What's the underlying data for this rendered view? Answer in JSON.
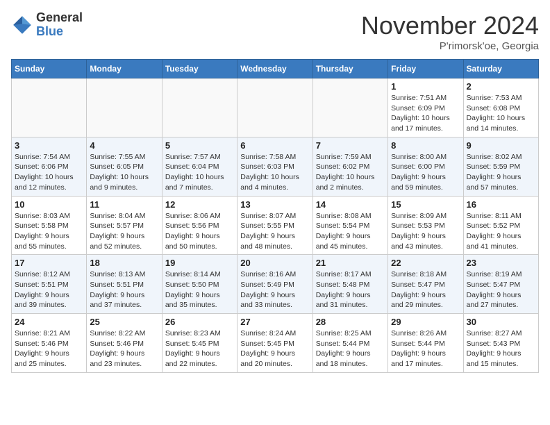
{
  "header": {
    "logo_general": "General",
    "logo_blue": "Blue",
    "month_title": "November 2024",
    "location": "P'rimorsk'oe, Georgia"
  },
  "weekdays": [
    "Sunday",
    "Monday",
    "Tuesday",
    "Wednesday",
    "Thursday",
    "Friday",
    "Saturday"
  ],
  "weeks": [
    [
      {
        "day": "",
        "info": ""
      },
      {
        "day": "",
        "info": ""
      },
      {
        "day": "",
        "info": ""
      },
      {
        "day": "",
        "info": ""
      },
      {
        "day": "",
        "info": ""
      },
      {
        "day": "1",
        "info": "Sunrise: 7:51 AM\nSunset: 6:09 PM\nDaylight: 10 hours\nand 17 minutes."
      },
      {
        "day": "2",
        "info": "Sunrise: 7:53 AM\nSunset: 6:08 PM\nDaylight: 10 hours\nand 14 minutes."
      }
    ],
    [
      {
        "day": "3",
        "info": "Sunrise: 7:54 AM\nSunset: 6:06 PM\nDaylight: 10 hours\nand 12 minutes."
      },
      {
        "day": "4",
        "info": "Sunrise: 7:55 AM\nSunset: 6:05 PM\nDaylight: 10 hours\nand 9 minutes."
      },
      {
        "day": "5",
        "info": "Sunrise: 7:57 AM\nSunset: 6:04 PM\nDaylight: 10 hours\nand 7 minutes."
      },
      {
        "day": "6",
        "info": "Sunrise: 7:58 AM\nSunset: 6:03 PM\nDaylight: 10 hours\nand 4 minutes."
      },
      {
        "day": "7",
        "info": "Sunrise: 7:59 AM\nSunset: 6:02 PM\nDaylight: 10 hours\nand 2 minutes."
      },
      {
        "day": "8",
        "info": "Sunrise: 8:00 AM\nSunset: 6:00 PM\nDaylight: 9 hours\nand 59 minutes."
      },
      {
        "day": "9",
        "info": "Sunrise: 8:02 AM\nSunset: 5:59 PM\nDaylight: 9 hours\nand 57 minutes."
      }
    ],
    [
      {
        "day": "10",
        "info": "Sunrise: 8:03 AM\nSunset: 5:58 PM\nDaylight: 9 hours\nand 55 minutes."
      },
      {
        "day": "11",
        "info": "Sunrise: 8:04 AM\nSunset: 5:57 PM\nDaylight: 9 hours\nand 52 minutes."
      },
      {
        "day": "12",
        "info": "Sunrise: 8:06 AM\nSunset: 5:56 PM\nDaylight: 9 hours\nand 50 minutes."
      },
      {
        "day": "13",
        "info": "Sunrise: 8:07 AM\nSunset: 5:55 PM\nDaylight: 9 hours\nand 48 minutes."
      },
      {
        "day": "14",
        "info": "Sunrise: 8:08 AM\nSunset: 5:54 PM\nDaylight: 9 hours\nand 45 minutes."
      },
      {
        "day": "15",
        "info": "Sunrise: 8:09 AM\nSunset: 5:53 PM\nDaylight: 9 hours\nand 43 minutes."
      },
      {
        "day": "16",
        "info": "Sunrise: 8:11 AM\nSunset: 5:52 PM\nDaylight: 9 hours\nand 41 minutes."
      }
    ],
    [
      {
        "day": "17",
        "info": "Sunrise: 8:12 AM\nSunset: 5:51 PM\nDaylight: 9 hours\nand 39 minutes."
      },
      {
        "day": "18",
        "info": "Sunrise: 8:13 AM\nSunset: 5:51 PM\nDaylight: 9 hours\nand 37 minutes."
      },
      {
        "day": "19",
        "info": "Sunrise: 8:14 AM\nSunset: 5:50 PM\nDaylight: 9 hours\nand 35 minutes."
      },
      {
        "day": "20",
        "info": "Sunrise: 8:16 AM\nSunset: 5:49 PM\nDaylight: 9 hours\nand 33 minutes."
      },
      {
        "day": "21",
        "info": "Sunrise: 8:17 AM\nSunset: 5:48 PM\nDaylight: 9 hours\nand 31 minutes."
      },
      {
        "day": "22",
        "info": "Sunrise: 8:18 AM\nSunset: 5:47 PM\nDaylight: 9 hours\nand 29 minutes."
      },
      {
        "day": "23",
        "info": "Sunrise: 8:19 AM\nSunset: 5:47 PM\nDaylight: 9 hours\nand 27 minutes."
      }
    ],
    [
      {
        "day": "24",
        "info": "Sunrise: 8:21 AM\nSunset: 5:46 PM\nDaylight: 9 hours\nand 25 minutes."
      },
      {
        "day": "25",
        "info": "Sunrise: 8:22 AM\nSunset: 5:46 PM\nDaylight: 9 hours\nand 23 minutes."
      },
      {
        "day": "26",
        "info": "Sunrise: 8:23 AM\nSunset: 5:45 PM\nDaylight: 9 hours\nand 22 minutes."
      },
      {
        "day": "27",
        "info": "Sunrise: 8:24 AM\nSunset: 5:45 PM\nDaylight: 9 hours\nand 20 minutes."
      },
      {
        "day": "28",
        "info": "Sunrise: 8:25 AM\nSunset: 5:44 PM\nDaylight: 9 hours\nand 18 minutes."
      },
      {
        "day": "29",
        "info": "Sunrise: 8:26 AM\nSunset: 5:44 PM\nDaylight: 9 hours\nand 17 minutes."
      },
      {
        "day": "30",
        "info": "Sunrise: 8:27 AM\nSunset: 5:43 PM\nDaylight: 9 hours\nand 15 minutes."
      }
    ]
  ]
}
